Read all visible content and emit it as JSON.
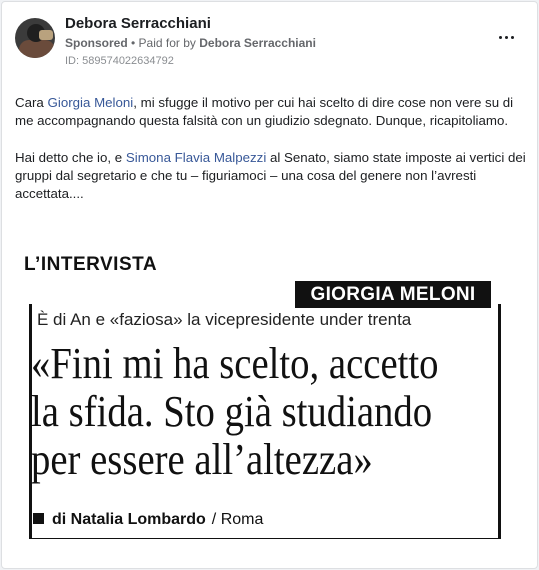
{
  "post": {
    "author": "Debora Serracchiani",
    "sponsored_label": "Sponsored",
    "separator": " • ",
    "paid_for_label": "Paid for by ",
    "paid_for_name": "Debora Serracchiani",
    "ad_id": "ID: 589574022634792",
    "more_icon": "more-options-icon"
  },
  "text": {
    "p1_before": "Cara ",
    "p1_link": "Giorgia Meloni",
    "p1_after": ", mi sfugge il motivo per cui hai scelto di dire cose non vere su di me accompagnando questa falsità con un giudizio sdegnato. Dunque, ricapitoliamo.",
    "p2_before": "Hai detto che io, e ",
    "p2_link": "Simona Flavia Malpezzi",
    "p2_after": " al Senato, siamo state imposte ai vertici dei gruppi dal segretario e che tu – figuriamoci – una cosa del genere non l’avresti accettata...."
  },
  "clipping": {
    "section": "L’INTERVISTA",
    "person": "GIORGIA MELONI",
    "kicker": "È di An e «faziosa» la vicepresidente under trenta",
    "headline_1": "«Fini mi ha scelto, accetto",
    "headline_2": "la sfida. Sto già studiando",
    "headline_3": "per essere all’altezza»",
    "byline_author": "di Natalia Lombardo",
    "byline_place": "/ Roma"
  },
  "colors": {
    "link": "#385898",
    "background": "#f0f2f5"
  }
}
